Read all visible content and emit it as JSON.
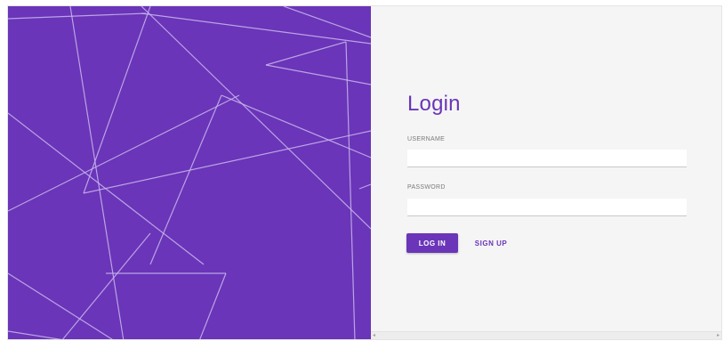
{
  "login": {
    "title": "Login",
    "username_label": "USERNAME",
    "username_value": "",
    "password_label": "PASSWORD",
    "password_value": "",
    "login_button": "LOG IN",
    "signup_button": "SIGN UP"
  },
  "colors": {
    "accent": "#6a35b8",
    "panel_bg": "#f5f5f5",
    "line": "#c9b6ee"
  },
  "icons": {
    "scroll_left": "◂",
    "scroll_right": "▸"
  }
}
